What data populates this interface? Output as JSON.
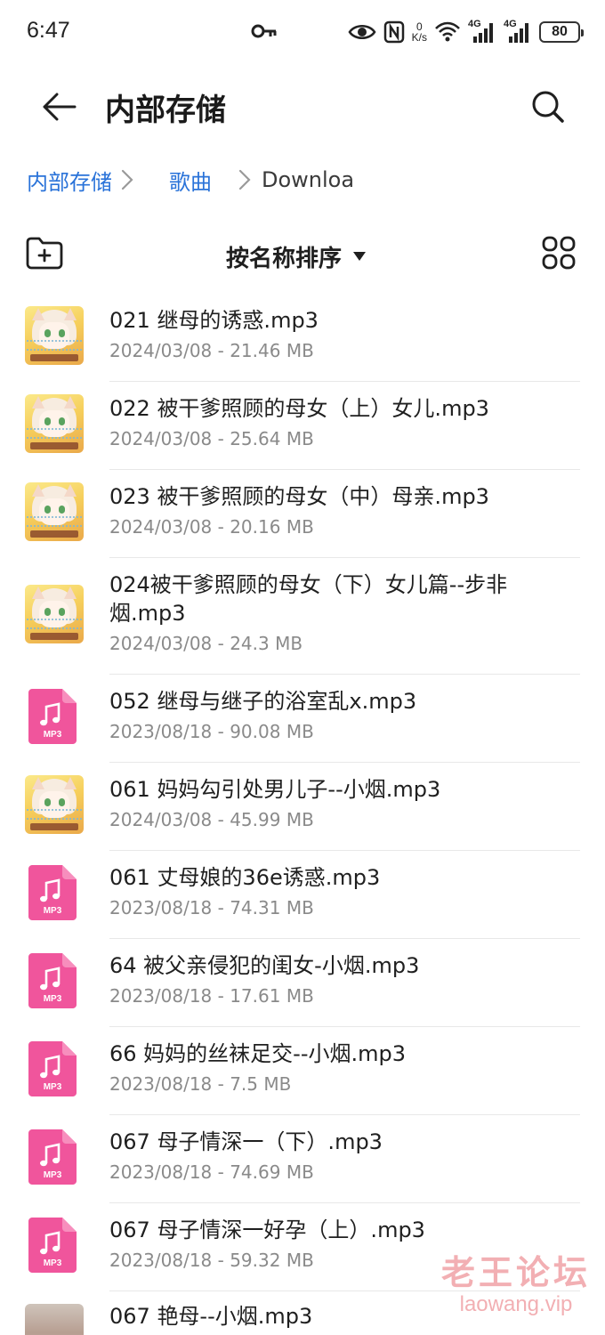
{
  "status_bar": {
    "time": "6:47",
    "net_speed_value": "0",
    "net_speed_unit": "K/s",
    "signal_1_label": "4G",
    "signal_2_label": "4G",
    "battery": "80"
  },
  "header": {
    "title": "内部存储"
  },
  "breadcrumb": {
    "items": [
      "内部存储",
      "歌曲"
    ],
    "current": "Downloa"
  },
  "toolbar": {
    "sort_label": "按名称排序"
  },
  "files": [
    {
      "name": "021 继母的诱惑.mp3",
      "meta": "2024/03/08 - 21.46 MB",
      "thumb": "anime"
    },
    {
      "name": "022 被干爹照顾的母女（上）女儿.mp3",
      "meta": "2024/03/08 - 25.64 MB",
      "thumb": "anime"
    },
    {
      "name": "023 被干爹照顾的母女（中）母亲.mp3",
      "meta": "2024/03/08 - 20.16 MB",
      "thumb": "anime"
    },
    {
      "name": "024被干爹照顾的母女（下）女儿篇--步非烟.mp3",
      "meta": "2024/03/08 - 24.3 MB",
      "thumb": "anime"
    },
    {
      "name": "052 继母与继子的浴室乱x.mp3",
      "meta": "2023/08/18 - 90.08 MB",
      "thumb": "mp3"
    },
    {
      "name": "061 妈妈勾引处男儿子--小烟.mp3",
      "meta": "2024/03/08 - 45.99 MB",
      "thumb": "anime"
    },
    {
      "name": "061 丈母娘的36e诱惑.mp3",
      "meta": "2023/08/18 - 74.31 MB",
      "thumb": "mp3"
    },
    {
      "name": "64 被父亲侵犯的闺女-小烟.mp3",
      "meta": "2023/08/18 - 17.61 MB",
      "thumb": "mp3"
    },
    {
      "name": "66 妈妈的丝袜足交--小烟.mp3",
      "meta": "2023/08/18 - 7.5 MB",
      "thumb": "mp3"
    },
    {
      "name": "067 母子情深一（下）.mp3",
      "meta": "2023/08/18 - 74.69 MB",
      "thumb": "mp3"
    },
    {
      "name": "067 母子情深一好孕（上）.mp3",
      "meta": "2023/08/18 - 59.32 MB",
      "thumb": "mp3"
    },
    {
      "name": "067 艳母--小烟.mp3",
      "meta": "",
      "thumb": "photo"
    }
  ],
  "mp3_badge": "MP3",
  "watermark": {
    "cn": "老王论坛",
    "en": "laowang.vip"
  },
  "colors": {
    "accent": "#2a73d9",
    "mp3_icon": "#f0559c",
    "divider": "#e8e8e8",
    "meta_text": "#8a8a8a"
  }
}
